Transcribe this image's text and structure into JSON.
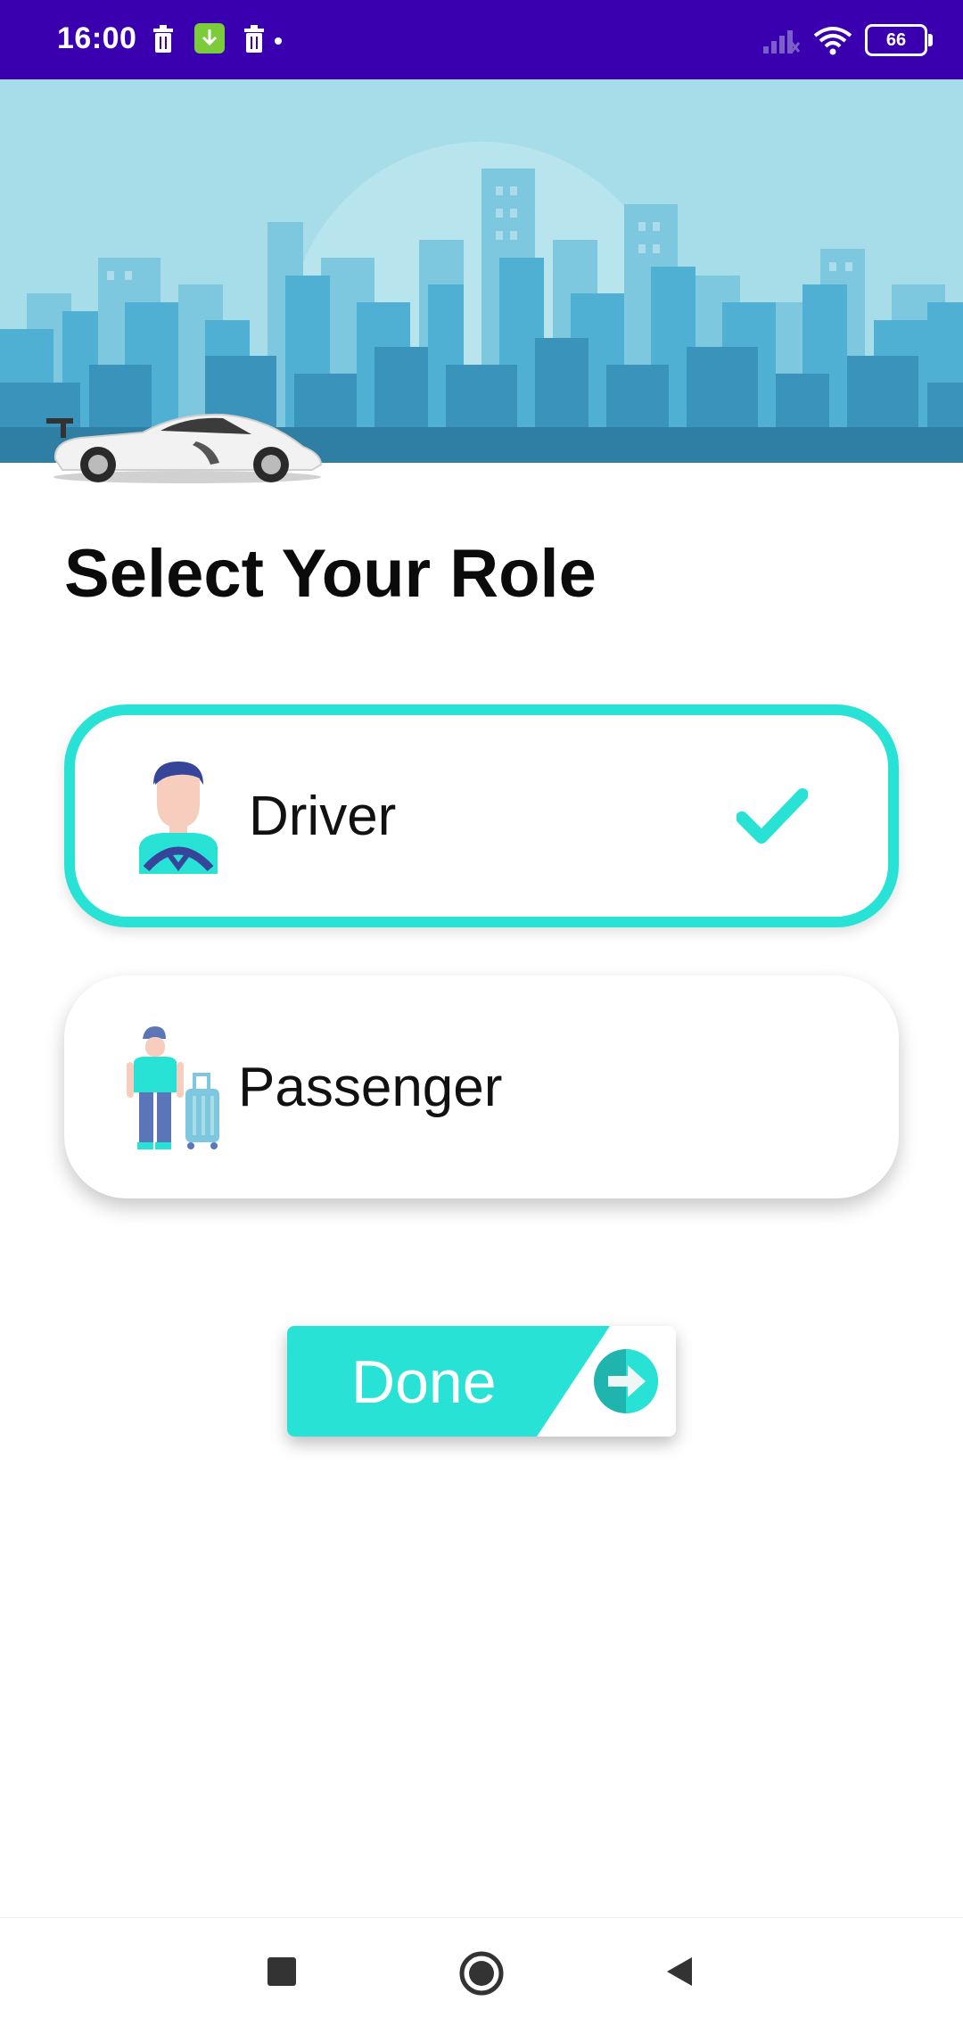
{
  "status_bar": {
    "time": "16:00",
    "battery": "66",
    "icons": [
      "trash-icon",
      "download-icon",
      "trash-icon",
      "dot-icon",
      "signal-icon",
      "wifi-icon",
      "battery-icon"
    ]
  },
  "page": {
    "title": "Select Your Role"
  },
  "roles": [
    {
      "label": "Driver",
      "selected": true,
      "icon": "driver-avatar-icon"
    },
    {
      "label": "Passenger",
      "selected": false,
      "icon": "passenger-avatar-icon"
    }
  ],
  "actions": {
    "done_label": "Done"
  },
  "nav": {
    "items": [
      "recents-button",
      "home-button",
      "back-button"
    ]
  },
  "colors": {
    "accent": "#27e2d5",
    "status_bar": "#3a00b0",
    "sky": "#a6dde8"
  }
}
